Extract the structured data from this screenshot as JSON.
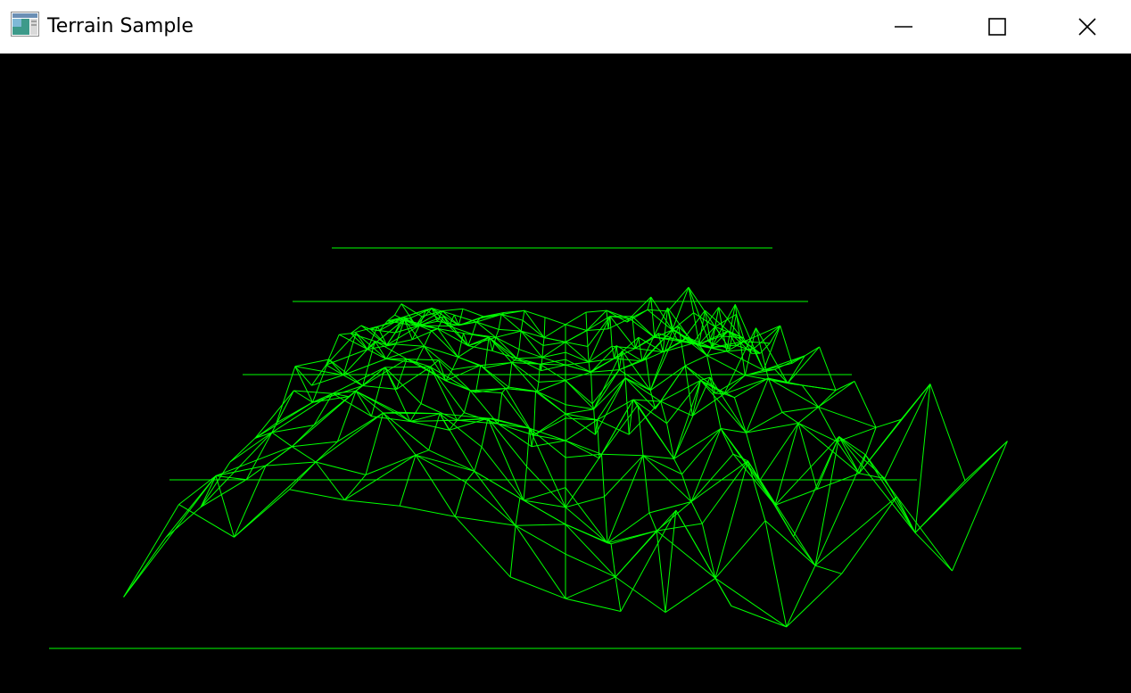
{
  "window": {
    "title": "Terrain Sample",
    "icons": {
      "app": "app-window-icon",
      "minimize": "minimize-icon",
      "maximize": "maximize-icon",
      "close": "close-icon"
    }
  },
  "viewport": {
    "background_color": "#000000",
    "wireframe_color": "#00ff00"
  }
}
